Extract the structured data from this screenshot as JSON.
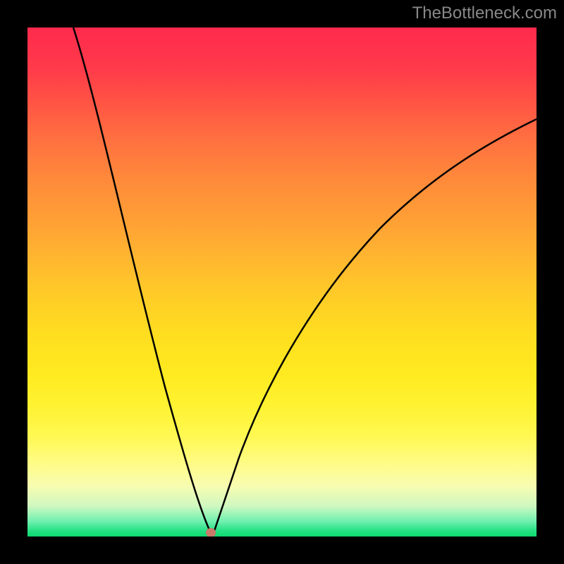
{
  "watermark": "TheBottleneck.com",
  "chart_data": {
    "type": "line",
    "title": "",
    "xlabel": "",
    "ylabel": "",
    "xlim": [
      0,
      100
    ],
    "ylim": [
      0,
      100
    ],
    "gradient_stops": [
      {
        "position": 0,
        "color": "#ff2a4d"
      },
      {
        "position": 50,
        "color": "#ffdd20"
      },
      {
        "position": 85,
        "color": "#fffb80"
      },
      {
        "position": 100,
        "color": "#10d870"
      }
    ],
    "minimum_point": {
      "x": 36,
      "y": 99
    },
    "curve_left": [
      {
        "x": 9,
        "y": 0
      },
      {
        "x": 14,
        "y": 22
      },
      {
        "x": 19,
        "y": 42
      },
      {
        "x": 24,
        "y": 62
      },
      {
        "x": 29,
        "y": 80
      },
      {
        "x": 33,
        "y": 93
      },
      {
        "x": 36,
        "y": 99
      }
    ],
    "curve_right": [
      {
        "x": 36,
        "y": 99
      },
      {
        "x": 38.5,
        "y": 93
      },
      {
        "x": 42,
        "y": 82
      },
      {
        "x": 48,
        "y": 68
      },
      {
        "x": 56,
        "y": 53
      },
      {
        "x": 66,
        "y": 40
      },
      {
        "x": 78,
        "y": 30
      },
      {
        "x": 90,
        "y": 23
      },
      {
        "x": 100,
        "y": 18
      }
    ]
  }
}
